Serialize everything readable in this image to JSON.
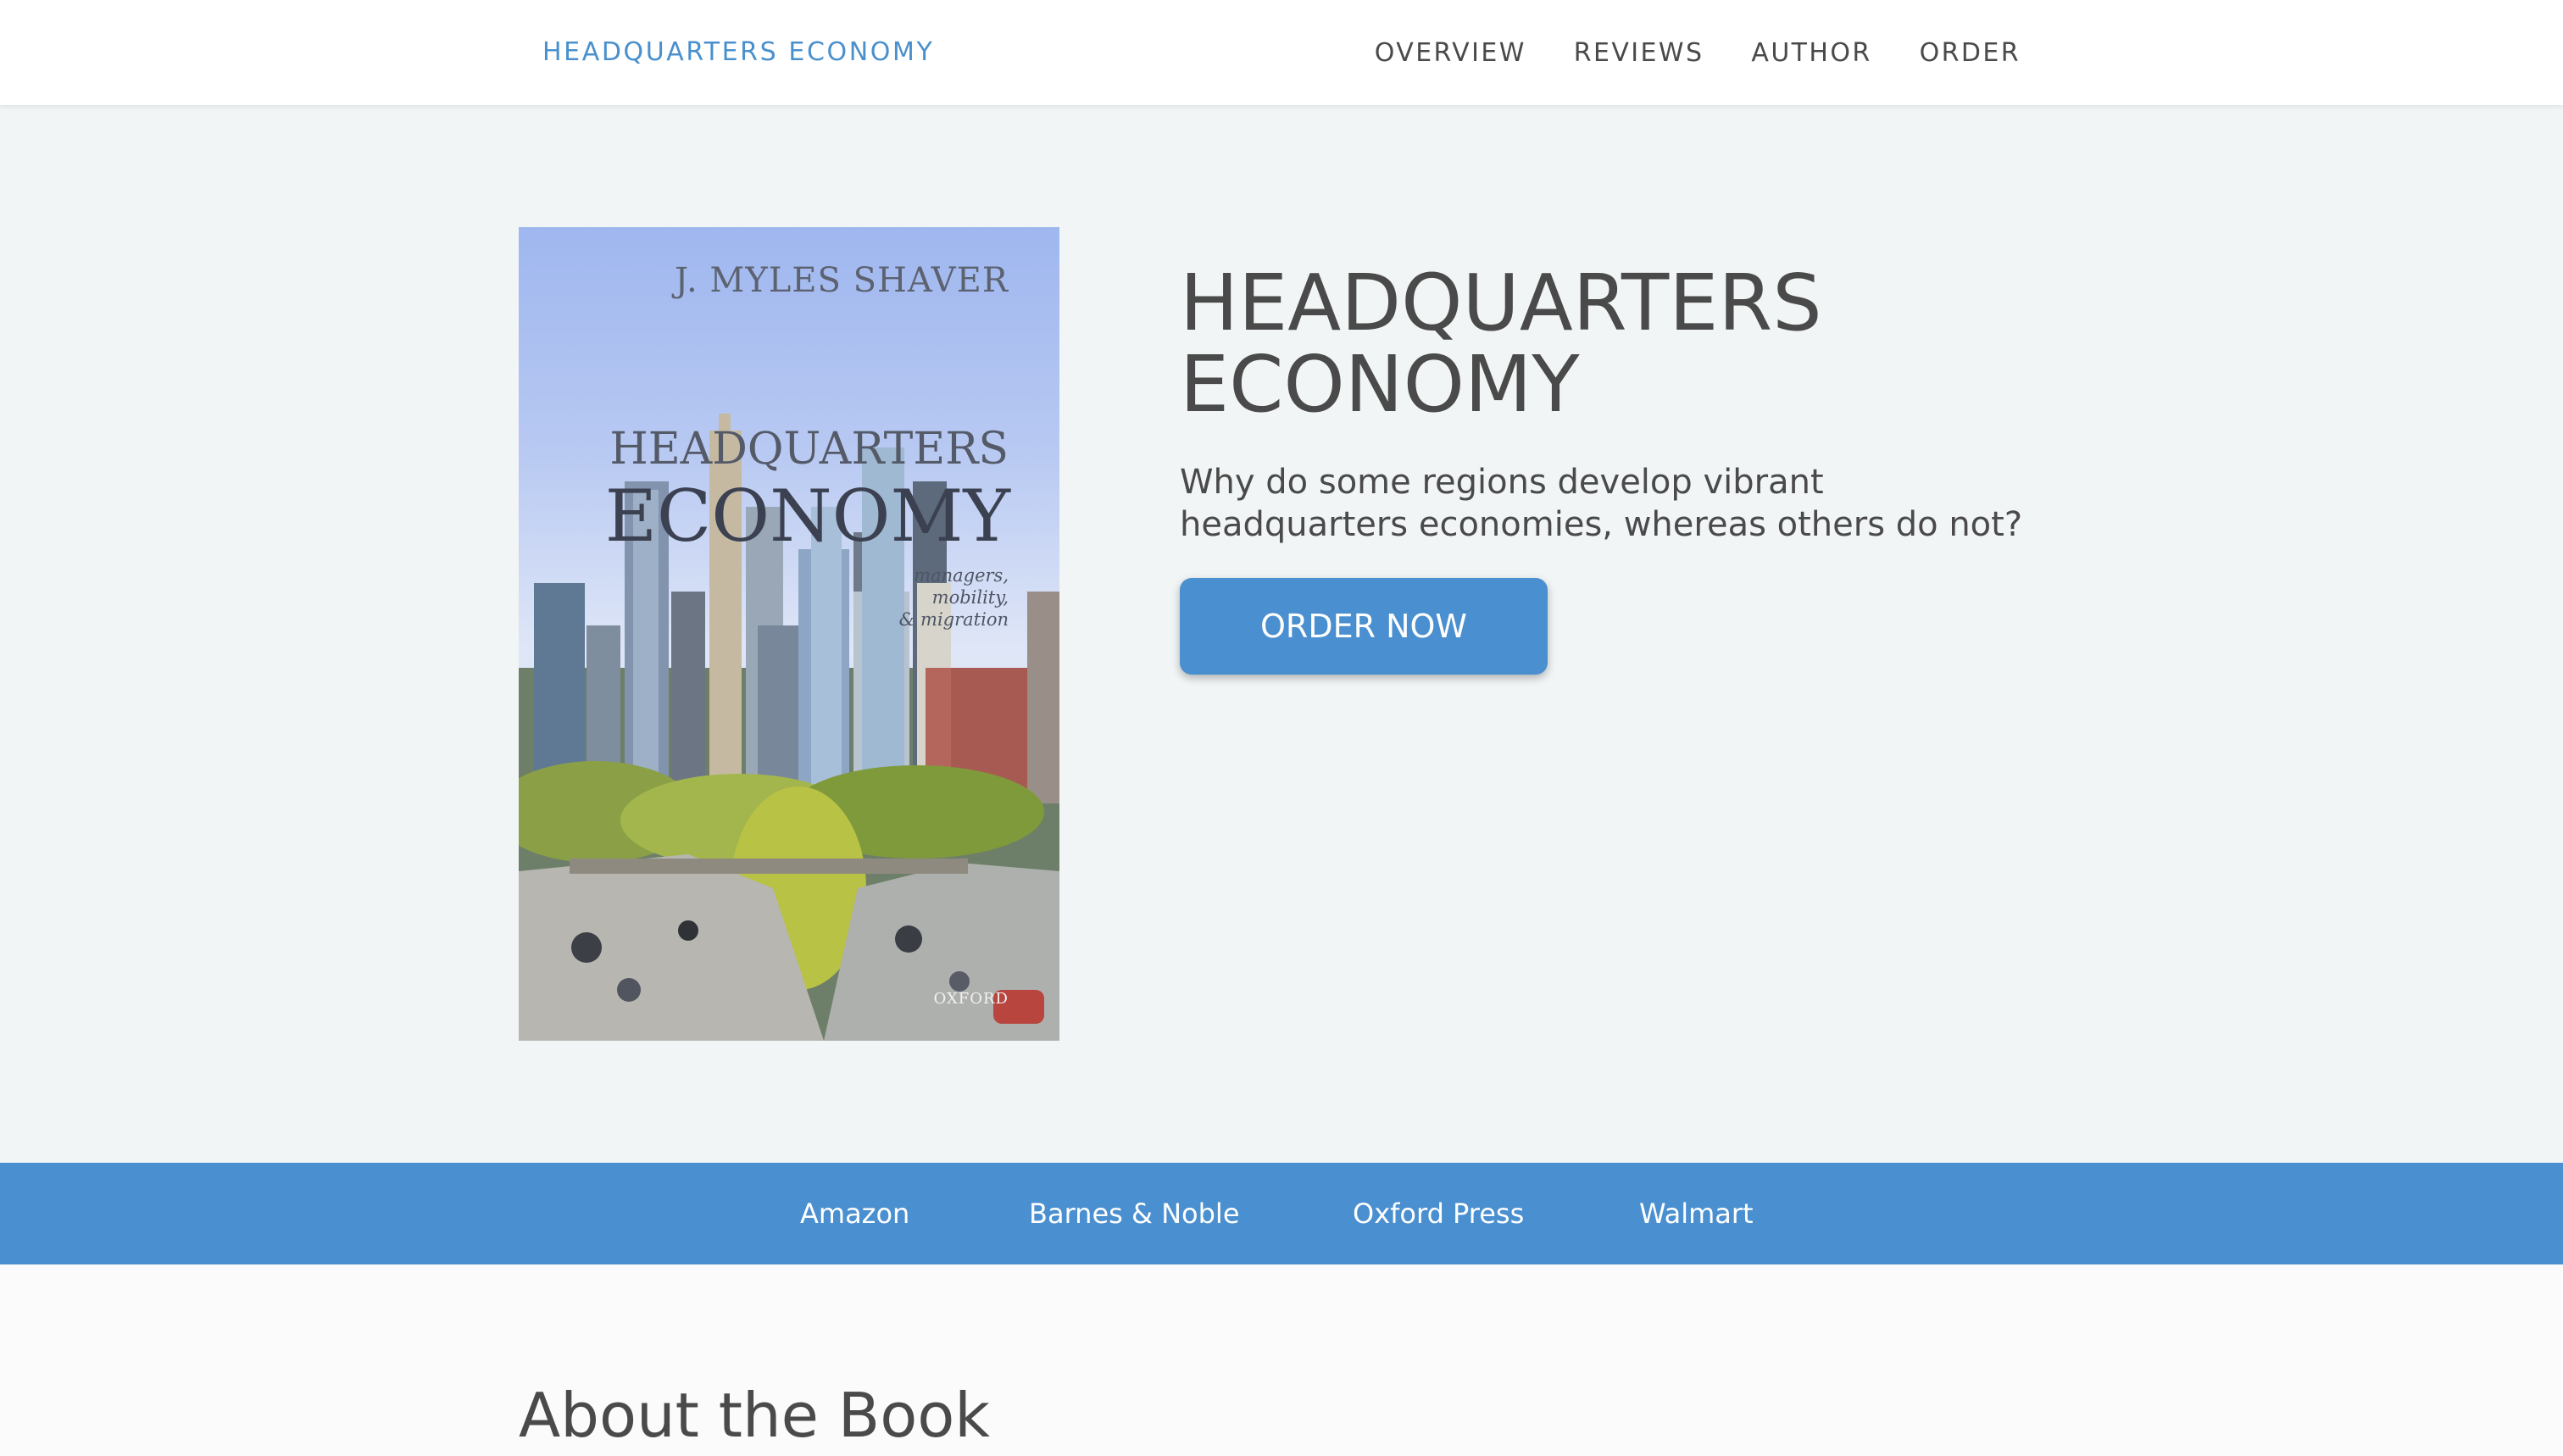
{
  "nav": {
    "brand": "HEADQUARTERS ECONOMY",
    "links": [
      "OVERVIEW",
      "REVIEWS",
      "AUTHOR",
      "ORDER"
    ]
  },
  "hero": {
    "cover": {
      "author": "J. MYLES SHAVER",
      "title_line1": "HEADQUARTERS",
      "title_line2": "ECONOMY",
      "subtitle_lines": [
        "managers,",
        "mobility,",
        "& migration"
      ],
      "publisher": "OXFORD"
    },
    "title": "HEADQUARTERS ECONOMY",
    "subtitle": "Why do some regions develop vibrant headquarters economies, whereas others do not?",
    "cta_label": "ORDER NOW"
  },
  "retailers": [
    "Amazon",
    "Barnes & Noble",
    "Oxford Press",
    "Walmart"
  ],
  "about": {
    "title": "About the Book"
  },
  "colors": {
    "accent": "#4a8fcf",
    "text": "#4a4a4a",
    "hero_bg": "#f1f5f6"
  }
}
